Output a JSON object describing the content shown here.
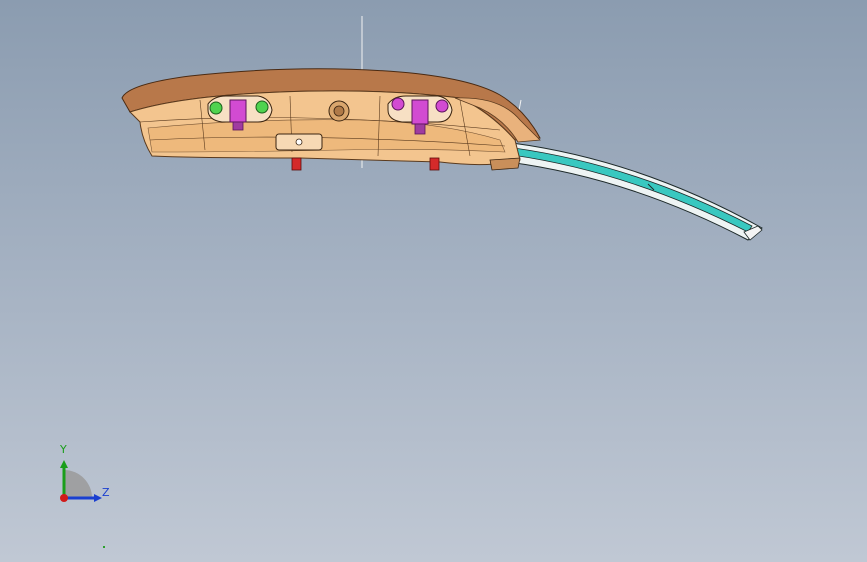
{
  "viewport": {
    "background_top": "#8b9cb0",
    "background_bottom": "#c0c8d4"
  },
  "model": {
    "part_icon": "headlamp-housing-icon",
    "colors": {
      "housing_body": "#f3c58f",
      "housing_top": "#b8784a",
      "edge_lines": "#5a3a1e",
      "bracket_left": "#4fd34f",
      "clip_magenta": "#d24bd2",
      "connector_red": "#d42a2a",
      "trim_strip": "#39c8c0",
      "trim_edge": "#e8f2f2"
    }
  },
  "triad": {
    "icon": "coordinate-triad-icon",
    "y_label": "Y",
    "z_label": "Z",
    "colors": {
      "y": "#1a9e1a",
      "z": "#1a3fd0",
      "x": "#d01a1a"
    }
  }
}
